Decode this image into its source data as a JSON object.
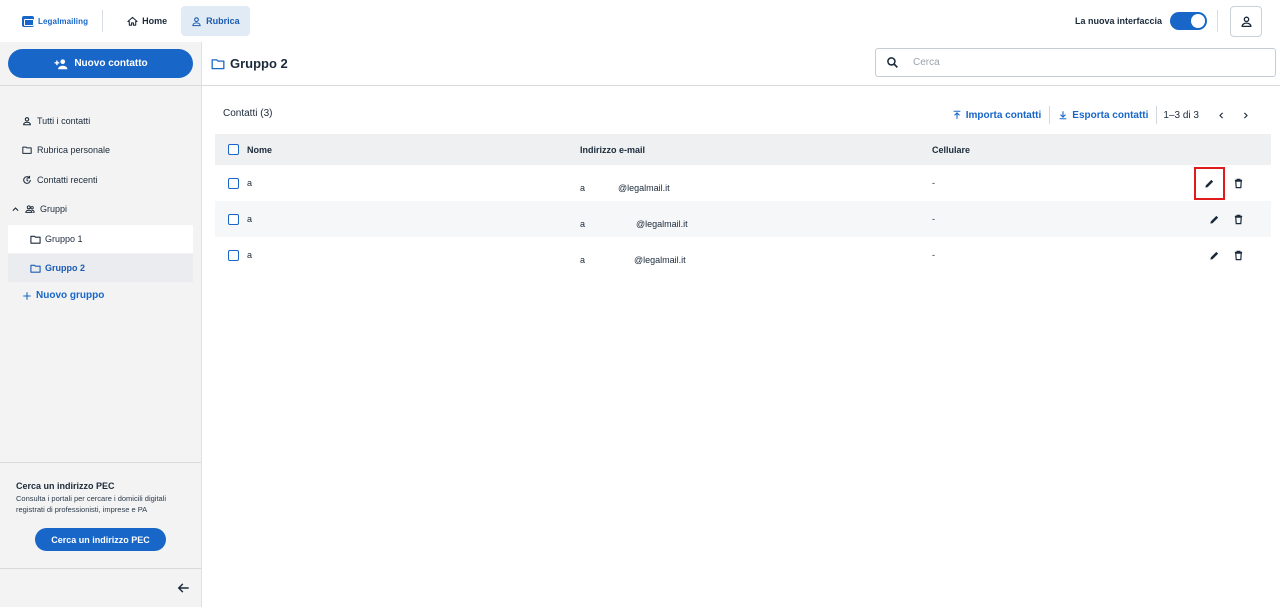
{
  "brand": {
    "name": "Legalmailing"
  },
  "nav": {
    "home": "Home",
    "rubrica": "Rubrica"
  },
  "topright": {
    "newui_label": "La nuova interfaccia",
    "newui_enabled": true
  },
  "sidebar": {
    "new_contact": "Nuovo contatto",
    "items": [
      {
        "label": "Tutti i contatti",
        "icon": "person-icon"
      },
      {
        "label": "Rubrica personale",
        "icon": "folder-icon"
      },
      {
        "label": "Contatti recenti",
        "icon": "history-icon"
      },
      {
        "label": "Gruppi",
        "icon": "group-icon"
      }
    ],
    "groups": [
      "Gruppo 1",
      "Gruppo 2"
    ],
    "new_group": "Nuovo gruppo",
    "pec": {
      "title": "Cerca un indirizzo PEC",
      "desc": "Consulta i portali per cercare i domicili digitali registrati di professionisti, imprese e PA",
      "button": "Cerca un indirizzo PEC"
    }
  },
  "header": {
    "title": "Gruppo 2",
    "search_placeholder": "Cerca"
  },
  "toolbar": {
    "count": "Contatti (3)",
    "import": "Importa contatti",
    "export": "Esporta contatti",
    "pager": "1–3 di 3"
  },
  "table": {
    "columns": {
      "name": "Nome",
      "email": "Indirizzo e-mail",
      "cell": "Cellulare"
    },
    "rows": [
      {
        "name": "a",
        "email_prefix": "a",
        "email_domain": "@legalmail.it",
        "cell": "-"
      },
      {
        "name": "a",
        "email_prefix": "a",
        "email_domain": "@legalmail.it",
        "cell": "-"
      },
      {
        "name": "a",
        "email_prefix": "a",
        "email_domain": "@legalmail.it",
        "cell": "-"
      }
    ]
  },
  "colors": {
    "accent": "#1766c8",
    "highlight": "#e01b1b"
  }
}
